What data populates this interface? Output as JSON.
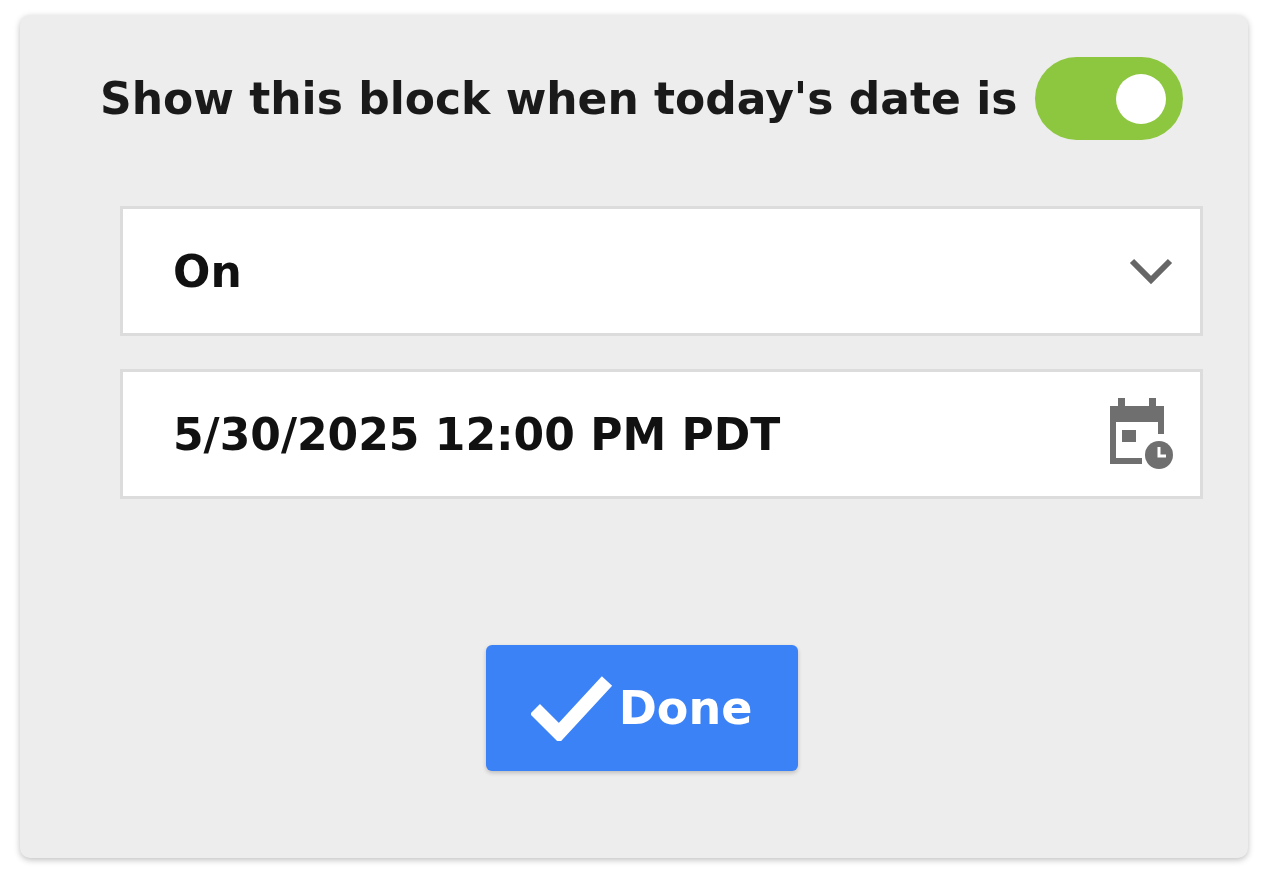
{
  "header": {
    "label": "Show this block when today's date is",
    "toggle_on": true
  },
  "condition_select": {
    "value": "On"
  },
  "date_field": {
    "value": "5/30/2025 12:00 PM PDT"
  },
  "done_button": {
    "label": "Done"
  }
}
